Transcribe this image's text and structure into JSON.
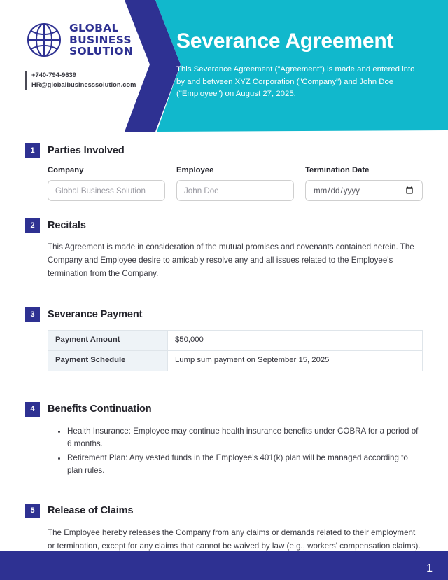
{
  "header": {
    "logo": {
      "icon": "globe-icon",
      "line1": "GLOBAL",
      "line2": "BUSINESS",
      "line3": "SOLUTION"
    },
    "contact": {
      "phone": "+740-794-9639",
      "email": "HR@globalbusinesssolution.com"
    },
    "title": "Severance Agreement",
    "intro": "This Severance Agreement (\"Agreement\") is made and entered into by and between XYZ Corporation (\"Company\") and John Doe (\"Employee\") on August 27, 2025."
  },
  "colors": {
    "navy": "#2e3192",
    "teal": "#11b8cc",
    "table_label_bg": "#eef3f7",
    "border": "#dfe5ea"
  },
  "sections": [
    {
      "number": "1",
      "title": "Parties Involved",
      "fields": [
        {
          "label": "Company",
          "placeholder": "Global Business Solution",
          "value": ""
        },
        {
          "label": "Employee",
          "placeholder": "John Doe",
          "value": ""
        },
        {
          "label": "Termination Date",
          "placeholder": "mm/dd/yyyy",
          "value": ""
        }
      ]
    },
    {
      "number": "2",
      "title": "Recitals",
      "paragraph": "This Agreement is made in consideration of the mutual promises and covenants contained herein. The Company and Employee desire to amicably resolve any and all issues related to the Employee's termination from the Company."
    },
    {
      "number": "3",
      "title": "Severance Payment",
      "table": [
        {
          "label": "Payment Amount",
          "value": "$50,000"
        },
        {
          "label": "Payment Schedule",
          "value": "Lump sum payment on September 15, 2025"
        }
      ]
    },
    {
      "number": "4",
      "title": "Benefits Continuation",
      "bullets": [
        "Health Insurance: Employee may continue health insurance benefits under COBRA for a period of 6 months.",
        "Retirement Plan: Any vested funds in the Employee's 401(k) plan will be managed according to plan rules."
      ]
    },
    {
      "number": "5",
      "title": "Release of Claims",
      "paragraph": "The Employee hereby releases the Company from any claims or demands related to their employment or termination, except for any claims that cannot be waived by law (e.g., workers' compensation claims)."
    }
  ],
  "footer": {
    "page_number": "1"
  }
}
